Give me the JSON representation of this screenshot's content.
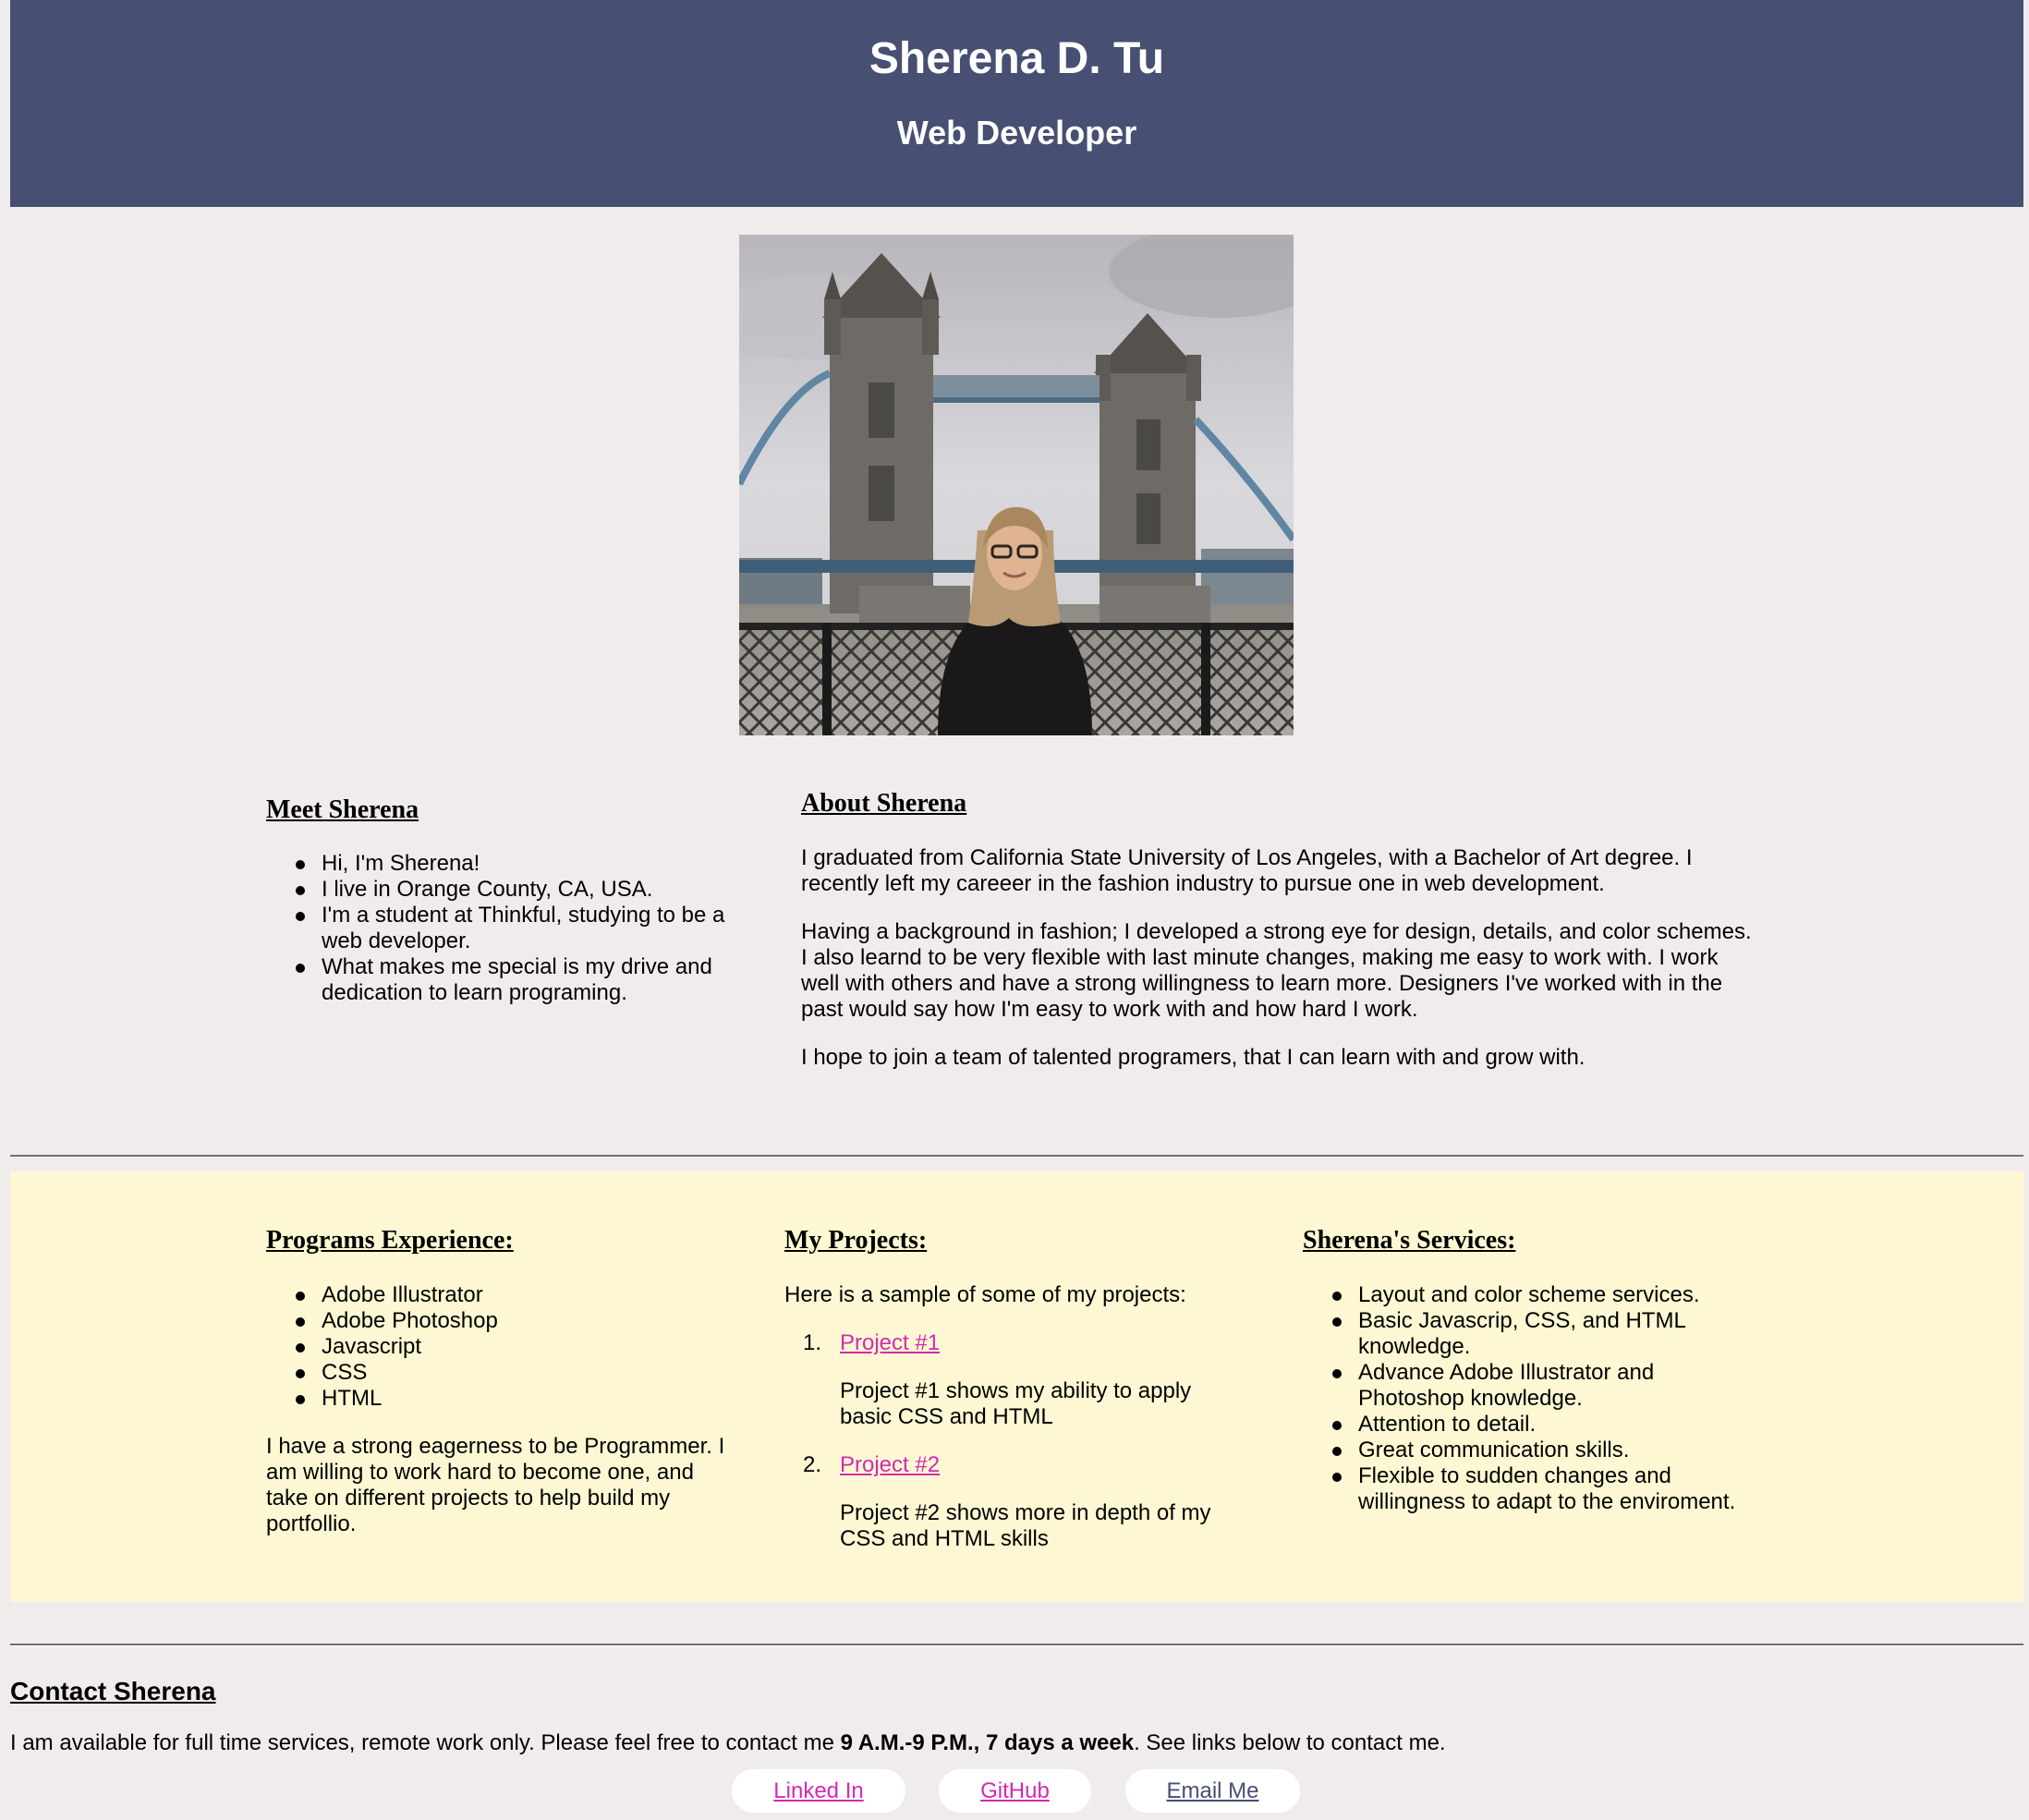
{
  "header": {
    "name": "Sherena D. Tu",
    "title": "Web Developer"
  },
  "meet": {
    "heading": "Meet Sherena",
    "items": [
      "Hi, I'm Sherena!",
      "I live in Orange County, CA, USA.",
      "I'm a student at Thinkful, studying to be a web developer.",
      "What makes me special is my drive and dedication to learn programing."
    ]
  },
  "about": {
    "heading": "About Sherena",
    "paragraphs": [
      "I graduated from California State University of Los Angeles, with a Bachelor of Art degree. I recently left my careeer in the fashion industry to pursue one in web development.",
      "Having a background in fashion; I developed a strong eye for design, details, and color schemes. I also learnd to be very flexible with last minute changes, making me easy to work with. I work well with others and have a strong willingness to learn more. Designers I've worked with in the past would say how I'm easy to work with and how hard I work.",
      "I hope to join a team of talented programers, that I can learn with and grow with."
    ]
  },
  "programs": {
    "heading": "Programs Experience:",
    "items": [
      "Adobe Illustrator",
      "Adobe Photoshop",
      "Javascript",
      "CSS",
      "HTML"
    ],
    "paragraph": "I have a strong eagerness to be Programmer. I am willing to work hard to become one, and take on different projects to help build my portfollio."
  },
  "projects": {
    "heading": "My Projects:",
    "intro": "Here is a sample of some of my projects:",
    "items": [
      {
        "number": "1.",
        "link": "Project #1",
        "description": "Project #1 shows my ability to apply basic CSS and HTML"
      },
      {
        "number": "2.",
        "link": "Project #2",
        "description": "Project #2 shows more in depth of my CSS and HTML skills"
      }
    ]
  },
  "services": {
    "heading": "Sherena's Services:",
    "items": [
      "Layout and color scheme services.",
      "Basic Javascrip, CSS, and HTML knowledge.",
      "Advance Adobe Illustrator and Photoshop knowledge.",
      "Attention to detail.",
      "Great communication skills.",
      "Flexible to sudden changes and willingness to adapt to the enviroment."
    ]
  },
  "contact": {
    "heading": "Contact Sherena",
    "text_before": "I am available for full time services, remote work only. Please feel free to contact me ",
    "text_bold": "9 A.M.-9 P.M., 7 days a week",
    "text_after": ". See links below to contact me.",
    "links": {
      "linkedin": "Linked In",
      "github": "GitHub",
      "email": "Email Me"
    }
  },
  "colors": {
    "header_bg": "#474f72",
    "page_bg": "#f1ecec",
    "section_bg": "#fdf8d3",
    "link_pink": "#d22bb0",
    "link_dark": "#474f72"
  },
  "icons": {
    "photo": "profile-photo-tower-bridge"
  }
}
